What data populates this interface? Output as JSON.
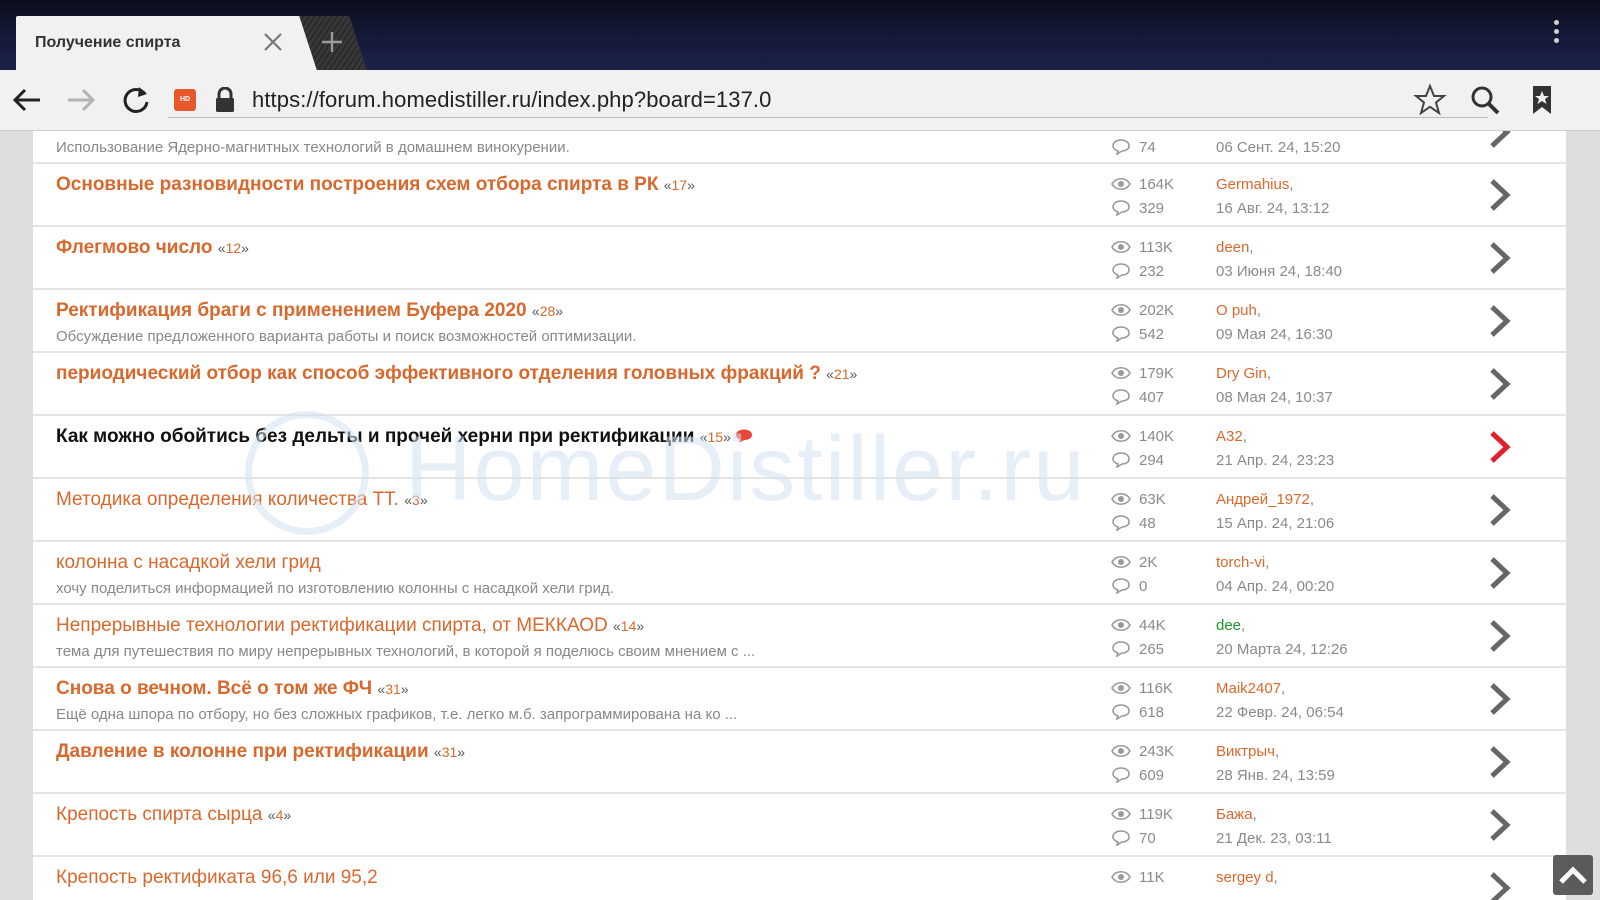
{
  "browser": {
    "tab_title": "Получение спирта",
    "url": "https://forum.homedistiller.ru/index.php?board=137.0",
    "favicon_text": "HD"
  },
  "watermark": "HomeDistiller.ru",
  "topics": [
    {
      "title": "",
      "pages": "",
      "description": "Использование Ядерно-магнитных технологий в домашнем винокурении.",
      "views": "",
      "replies": "74",
      "last_by": "",
      "last_date": "06 Сент. 24, 15:20",
      "style": "bold",
      "partial": true
    },
    {
      "title": "Основные разновидности построения схем отбора спирта в РК",
      "pages": "17",
      "description": "",
      "views": "164K",
      "replies": "329",
      "last_by": "Germahius",
      "last_date": "16 Авг. 24, 13:12",
      "style": "bold"
    },
    {
      "title": "Флегмово число",
      "pages": "12",
      "description": "",
      "views": "113K",
      "replies": "232",
      "last_by": "deen",
      "last_date": "03 Июня 24, 18:40",
      "style": "bold"
    },
    {
      "title": "Ректификация браги с применением Буфера 2020",
      "pages": "28",
      "description": "Обсуждение предложенного варианта работы и поиск возможностей оптимизации.",
      "views": "202K",
      "replies": "542",
      "last_by": "O puh",
      "last_date": "09 Мая 24, 16:30",
      "style": "bold"
    },
    {
      "title": "периодический отбор как способ эффективного отделения головных фракций ?",
      "pages": "21",
      "description": "",
      "views": "179K",
      "replies": "407",
      "last_by": "Dry Gin",
      "last_date": "08 Мая 24, 10:37",
      "style": "bold"
    },
    {
      "title": "Как можно обойтись без дельты и прочей херни при ректификации",
      "pages": "15",
      "description": "",
      "views": "140K",
      "replies": "294",
      "last_by": "A32",
      "last_date": "21 Апр. 24, 23:23",
      "style": "unread",
      "new_posts": true
    },
    {
      "title": "Методика определения количества ТТ.",
      "pages": "3",
      "description": "",
      "views": "63K",
      "replies": "48",
      "last_by": "Андрей_1972",
      "last_date": "15 Апр. 24, 21:06",
      "style": "normal"
    },
    {
      "title": "колонна с насадкой хели грид",
      "pages": "",
      "description": "хочу поделиться информацией по изготовлению колонны с насадкой хели грид.",
      "views": "2K",
      "replies": "0",
      "last_by": "torch-vi",
      "last_date": "04 Апр. 24, 00:20",
      "style": "normal"
    },
    {
      "title": "Непрерывные технологии ректификации спирта, от МЕККАОD",
      "pages": "14",
      "description": "тема для путешествия по миру непрерывных технологий, в которой я поделюсь своим мнением с ...",
      "views": "44K",
      "replies": "265",
      "last_by": "dee",
      "last_by_color": "green",
      "last_date": "20 Марта 24, 12:26",
      "style": "normal"
    },
    {
      "title": "Снова о вечном. Всё о том же ФЧ",
      "pages": "31",
      "description": "Ещё одна шпора по отбору, но без сложных графиков, т.е. легко м.б. запрограммирована на ко ...",
      "views": "116K",
      "replies": "618",
      "last_by": "Maik2407",
      "last_date": "22 Февр. 24, 06:54",
      "style": "bold"
    },
    {
      "title": "Давление в колонне при ректификации",
      "pages": "31",
      "description": "",
      "views": "243K",
      "replies": "609",
      "last_by": "Виктрыч",
      "last_date": "28 Янв. 24, 13:59",
      "style": "bold"
    },
    {
      "title": "Крепость спирта сырца",
      "pages": "4",
      "description": "",
      "views": "119K",
      "replies": "70",
      "last_by": "Бажа",
      "last_date": "21 Дек. 23, 03:11",
      "style": "normal"
    },
    {
      "title": "Крепость ректификата 96,6 или 95,2",
      "pages": "",
      "description": "",
      "views": "11K",
      "replies": "",
      "last_by": "sergey d",
      "last_date": "",
      "style": "normal",
      "partial": true
    }
  ],
  "colors": {
    "accent": "#d9682c",
    "unread_title": "#111111",
    "active_chevron": "#e0202a",
    "green_user": "#1a9a2a"
  }
}
